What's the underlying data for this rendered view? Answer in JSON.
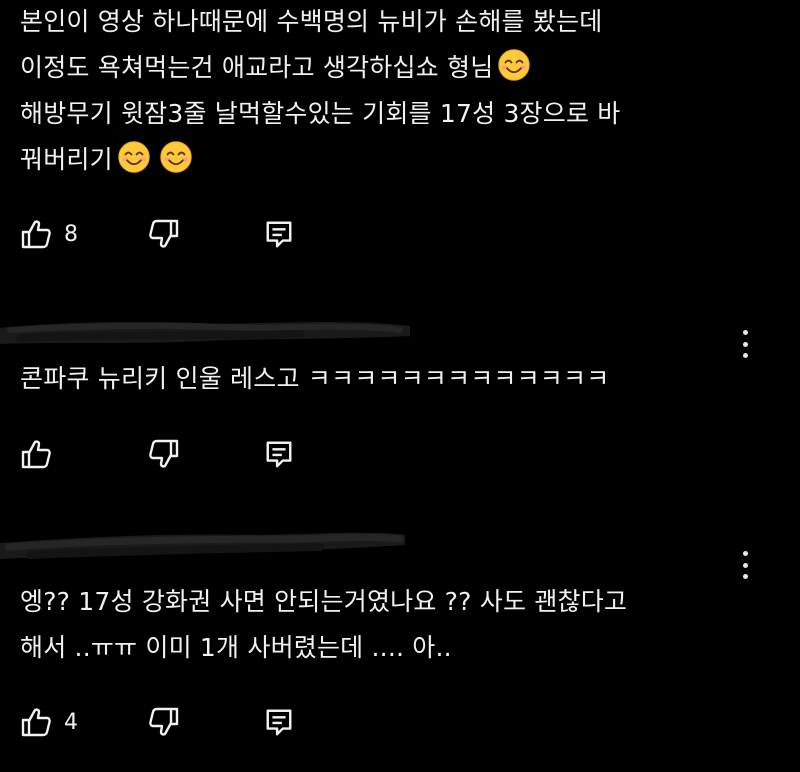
{
  "comments": [
    {
      "lines": [
        "본인이 영상 하나때문에 수백명의 뉴비가 손해를 봤는데",
        "이정도 욕쳐먹는건 애교라고 생각하십쇼 형님",
        "해방무기 윗잠3줄 날먹할수있는 기회를 17성 3장으로 바",
        "꿔버리기"
      ],
      "like_count": "8",
      "icons": [
        "thumbs-up-icon",
        "thumbs-down-icon",
        "reply-icon",
        "smiling-emoji-icon"
      ]
    },
    {
      "lines": [
        "콘파쿠 뉴리키 인울 레스고 ㅋㅋㅋㅋㅋㅋㅋㅋㅋㅋㅋㅋㅋ"
      ],
      "like_count": "",
      "icons": [
        "thumbs-up-icon",
        "thumbs-down-icon",
        "reply-icon",
        "more-vert-icon"
      ]
    },
    {
      "lines": [
        "엥?? 17성 강화권 사면 안되는거였나요 ?? 사도 괜찮다고",
        "해서 ..ㅠㅠ 이미 1개 사버렸는데 .... 아.."
      ],
      "like_count": "4",
      "icons": [
        "thumbs-up-icon",
        "thumbs-down-icon",
        "reply-icon",
        "more-vert-icon"
      ]
    }
  ],
  "colors": {
    "background": "#000000",
    "text": "#f1f1f1",
    "emoji_face": "#ffc83d"
  }
}
